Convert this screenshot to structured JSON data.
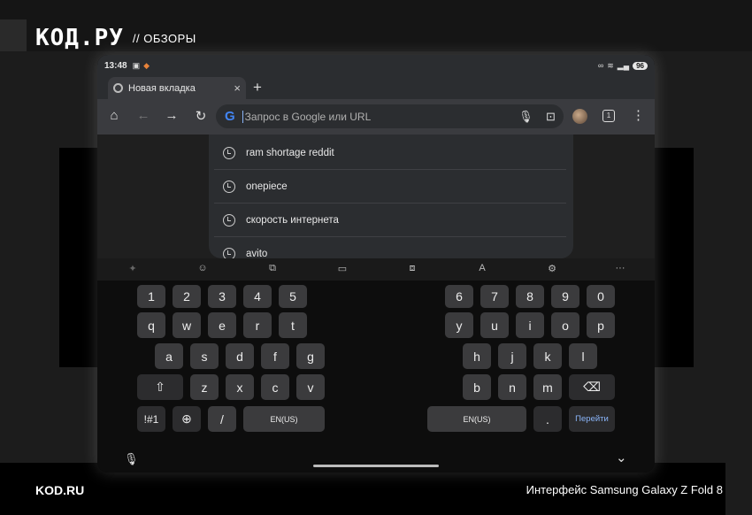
{
  "site": {
    "logo": "КОД.РУ",
    "section": "// ОБЗОРЫ",
    "footer_left": "KOD.RU",
    "footer_right": "Интерфейс Samsung Galaxy Z Fold 8"
  },
  "status": {
    "time": "13:48",
    "battery": "96"
  },
  "tab": {
    "title": "Новая вкладка",
    "close": "×",
    "new": "+"
  },
  "toolbar": {
    "home": "⌂",
    "back": "←",
    "forward": "→",
    "reload": "↻",
    "menu": "⋮",
    "tab_count": "1"
  },
  "omnibox": {
    "g": "G",
    "placeholder": "Запрос в Google или URL",
    "mic": "🎙",
    "lens": "⊡"
  },
  "suggestions": [
    {
      "text": "ram shortage reddit"
    },
    {
      "text": "onepiece"
    },
    {
      "text": "скорость интернета"
    },
    {
      "text": "avito"
    }
  ],
  "kb_toolbar": [
    "✦",
    "☺",
    "⧉",
    "▭",
    "⧈",
    "A",
    "⚙",
    "···"
  ],
  "keyboard": {
    "left": {
      "row1": [
        "1",
        "2",
        "3",
        "4",
        "5"
      ],
      "row2": [
        "q",
        "w",
        "e",
        "r",
        "t"
      ],
      "row3": [
        "a",
        "s",
        "d",
        "f",
        "g"
      ],
      "row4": [
        "⇧",
        "z",
        "x",
        "c",
        "v"
      ],
      "row5": [
        "!#1",
        "⊕",
        "/",
        "EN(US)"
      ]
    },
    "right": {
      "row1": [
        "6",
        "7",
        "8",
        "9",
        "0"
      ],
      "row2": [
        "y",
        "u",
        "i",
        "o",
        "p"
      ],
      "row3": [
        "h",
        "j",
        "k",
        "l"
      ],
      "row4": [
        "b",
        "n",
        "m",
        "⌫"
      ],
      "row5": [
        "EN(US)",
        ".",
        "Перейти"
      ]
    }
  },
  "bottom": {
    "mic": "🎙",
    "hide": "⌄"
  }
}
